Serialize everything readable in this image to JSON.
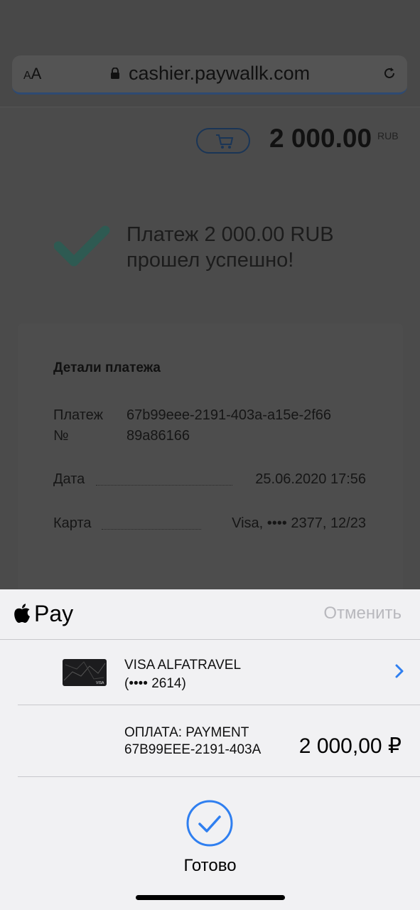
{
  "browser": {
    "text_size_label_small": "A",
    "text_size_label_large": "A",
    "url": "cashier.paywallk.com"
  },
  "header": {
    "amount": "2 000.00",
    "currency": "RUB"
  },
  "status": {
    "line1": "Платеж 2 000.00 RUB",
    "line2": "прошел успешно!"
  },
  "details": {
    "title": "Детали платежа",
    "payment_label_1": "Платеж",
    "payment_label_2": "№",
    "payment_id_1": "67b99eee-2191-403a-a15e-2f66",
    "payment_id_2": "89a86166",
    "date_label": "Дата",
    "date_value": "25.06.2020 17:56",
    "card_label": "Карта",
    "card_value": "Visa, •••• 2377, 12/23"
  },
  "apple_pay": {
    "logo_text": "Pay",
    "cancel": "Отменить",
    "card_name": "VISA ALFATRAVEL",
    "card_number": "(•••• 2614)",
    "payment_line1": "ОПЛАТА: PAYMENT",
    "payment_line2": "67B99EEE-2191-403A",
    "payment_amount": "2 000,00 ₽",
    "done": "Готово"
  },
  "colors": {
    "accent_blue": "#2f7ff0",
    "check_green": "#2e5a52"
  }
}
